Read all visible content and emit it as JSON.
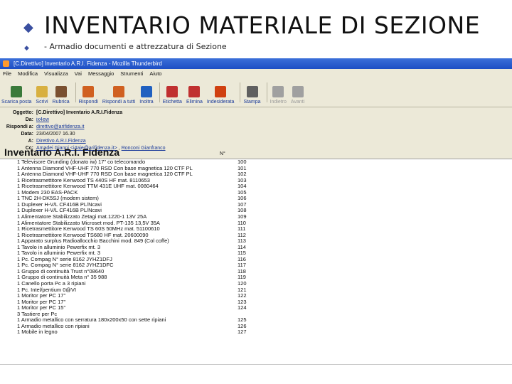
{
  "slide": {
    "title": "INVENTARIO MATERIALE DI SEZIONE",
    "subtitle": "- Armadio documenti e attrezzatura di Sezione",
    "bullet1": "◆",
    "bullet2": "◆"
  },
  "window": {
    "title": "[C.Direttivo] Inventario A.R.I. Fidenza - Mozilla Thunderbird",
    "menu": [
      "File",
      "Modifica",
      "Visualizza",
      "Vai",
      "Messaggio",
      "Strumenti",
      "Aiuto"
    ],
    "toolbar": [
      {
        "label": "Scarica posta",
        "icon": "download-mail-icon",
        "color": "#3a7a3a"
      },
      {
        "label": "Scrivi",
        "icon": "compose-icon",
        "color": "#d8b040"
      },
      {
        "label": "Rubrica",
        "icon": "address-book-icon",
        "color": "#7a5030"
      },
      {
        "label": "Rispondi",
        "icon": "reply-icon",
        "color": "#d06020"
      },
      {
        "label": "Rispondi a tutti",
        "icon": "reply-all-icon",
        "color": "#d06020"
      },
      {
        "label": "Inoltra",
        "icon": "forward-icon",
        "color": "#2060c0"
      },
      {
        "label": "Etichetta",
        "icon": "tag-icon",
        "color": "#c03030"
      },
      {
        "label": "Elimina",
        "icon": "delete-icon",
        "color": "#c03030"
      },
      {
        "label": "Indesiderata",
        "icon": "junk-icon",
        "color": "#d04010"
      },
      {
        "label": "Stampa",
        "icon": "print-icon",
        "color": "#606060"
      },
      {
        "label": "Indietro",
        "icon": "back-icon",
        "color": "#a0a0a0",
        "disabled": true
      },
      {
        "label": "Avanti",
        "icon": "forward-arrow-icon",
        "color": "#a0a0a0",
        "disabled": true
      }
    ]
  },
  "headers": {
    "subject_label": "Oggetto:",
    "subject": "[C.Direttivo] Inventario A.R.I.Fidenza",
    "from_label": "Da:",
    "from": "ix4ew",
    "replyto_label": "Rispondi a:",
    "replyto": "direttivo@arifidenza.it",
    "date_label": "Data:",
    "date": "23/04/2007 16.30",
    "to_label": "A:",
    "to": "Direttivo A.R.I.Fidenza",
    "cc_label": "Cc:",
    "cc1": "Amadei Gianni <i4aje@arifidenza.it>",
    "cc2": "Ronconi Gianfranco"
  },
  "document": {
    "title": "Inventario A.R.I. Fidenza",
    "number_header": "N°",
    "items": [
      {
        "text": "1 Televisore Grunding (donato iw) 17\" co telecomando",
        "n": "100"
      },
      {
        "text": "1 Antenna Diamond VHF-UHF 770 RSD Con base magnetica 120 CTF PL",
        "n": "101"
      },
      {
        "text": "1 Antenna Diamond VHF-UHF 770 RSD Con base magnetica 120 CTF PL",
        "n": "102"
      },
      {
        "text": "1 Ricetrasmettitore Kenwood TS 440S HF mat. 8110653",
        "n": "103"
      },
      {
        "text": "1 Ricetrasmettitore Kenwood TTM 431E UHF mat. 0080464",
        "n": "104"
      },
      {
        "text": "1 Modem 230 EAS-PACK",
        "n": "105"
      },
      {
        "text": "1 TNC 2H-DK5SJ (modem sistem)",
        "n": "106"
      },
      {
        "text": "1 Duplexer H-V/L CF416B PL/Ncavi",
        "n": "107"
      },
      {
        "text": "1 Duplexer H-V/L CF416B PL/Ncavi",
        "n": "108"
      },
      {
        "text": "1 Alimentatore Stabilizzato Zetagi mat.1220-1 13V 25A",
        "n": "109"
      },
      {
        "text": "1 Alimentatore Stabilizzato Microset mod. PT-135 13,5V 35A",
        "n": "110"
      },
      {
        "text": "1 Ricetrasmettitore Kenwood TS 60S 50MHz mat. 51100610",
        "n": "111"
      },
      {
        "text": "1 Ricetrasmettitore Kenwood TS680 HF mat. 20600090",
        "n": "112"
      },
      {
        "text": "1 Apparato surplus Radioallocchio Bacchini mod. 849 (Col coffe)",
        "n": "113"
      },
      {
        "text": "1 Tavolo in alluminio Pewerfix mt. 3",
        "n": "114"
      },
      {
        "text": "1 Tavolo in alluminio Pewerfix mt. 3",
        "n": "115"
      },
      {
        "text": "1 Pc. Compag N° serie 8162 JYHZ1DFJ",
        "n": "116"
      },
      {
        "text": "1 Pc. Compag N° serie 8162 JYHZ1DFC",
        "n": "117"
      },
      {
        "text": "1 Gruppo di continuità Trust n°08640",
        "n": "118"
      },
      {
        "text": "1 Gruppo di continuità Meta n° 35 988",
        "n": "119"
      },
      {
        "text": "1 Canello porta Pc a 3 ripiani",
        "n": "120"
      },
      {
        "text": "1 Pc. Intel/pentium 0@VI",
        "n": "121"
      },
      {
        "text": "1 Moritor per PC 17\"",
        "n": "122"
      },
      {
        "text": "1 Moritor per PC 17\"",
        "n": "123"
      },
      {
        "text": "1 Moritor per PC 15\"",
        "n": "124"
      },
      {
        "text": "3 Tastiere per Pc",
        "n": ""
      },
      {
        "text": "1 Armadio metallico con serratura 180x200x50 con sette ripiani",
        "n": "125"
      },
      {
        "text": "1 Armadio metallico con ripiani",
        "n": "126"
      },
      {
        "text": "1 Mobile in legno",
        "n": "127"
      }
    ]
  }
}
